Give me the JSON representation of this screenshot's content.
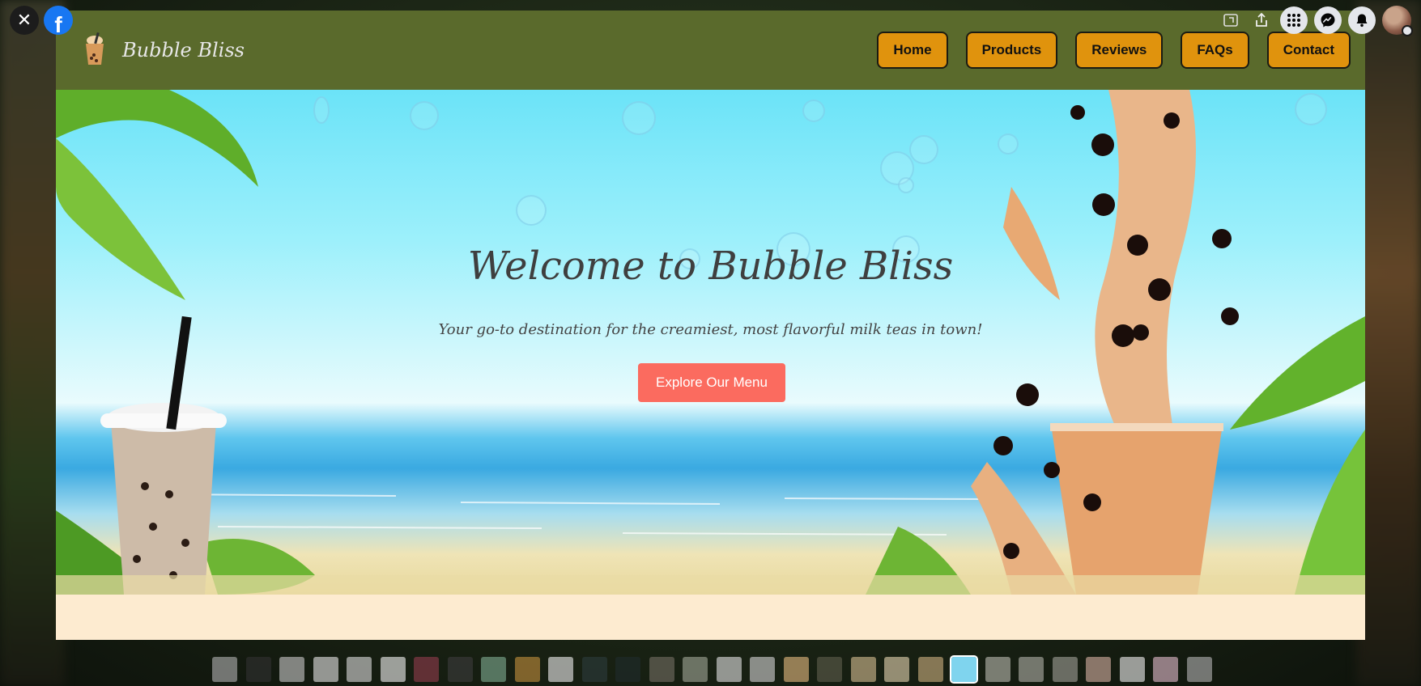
{
  "overlay": {
    "close_icon": "close-icon",
    "logo_icon": "facebook-logo-icon",
    "right_icons": [
      "rotate-icon",
      "share-icon",
      "grid-menu-icon",
      "messenger-icon",
      "bell-icon",
      "avatar"
    ]
  },
  "site": {
    "brand_name": "Bubble Bliss",
    "nav": [
      "Home",
      "Products",
      "Reviews",
      "FAQs",
      "Contact"
    ],
    "hero": {
      "title": "Welcome to Bubble Bliss",
      "subtitle": "Your go-to destination for the creamiest, most flavorful milk teas in town!",
      "cta": "Explore Our Menu"
    },
    "colors": {
      "nav_bg": "#5a6a2c",
      "nav_button": "#e0930d",
      "cta": "#fb6b5f",
      "footer_band": "#fdebd0"
    }
  },
  "thumbnails": {
    "count": 30,
    "active_index": 22
  }
}
